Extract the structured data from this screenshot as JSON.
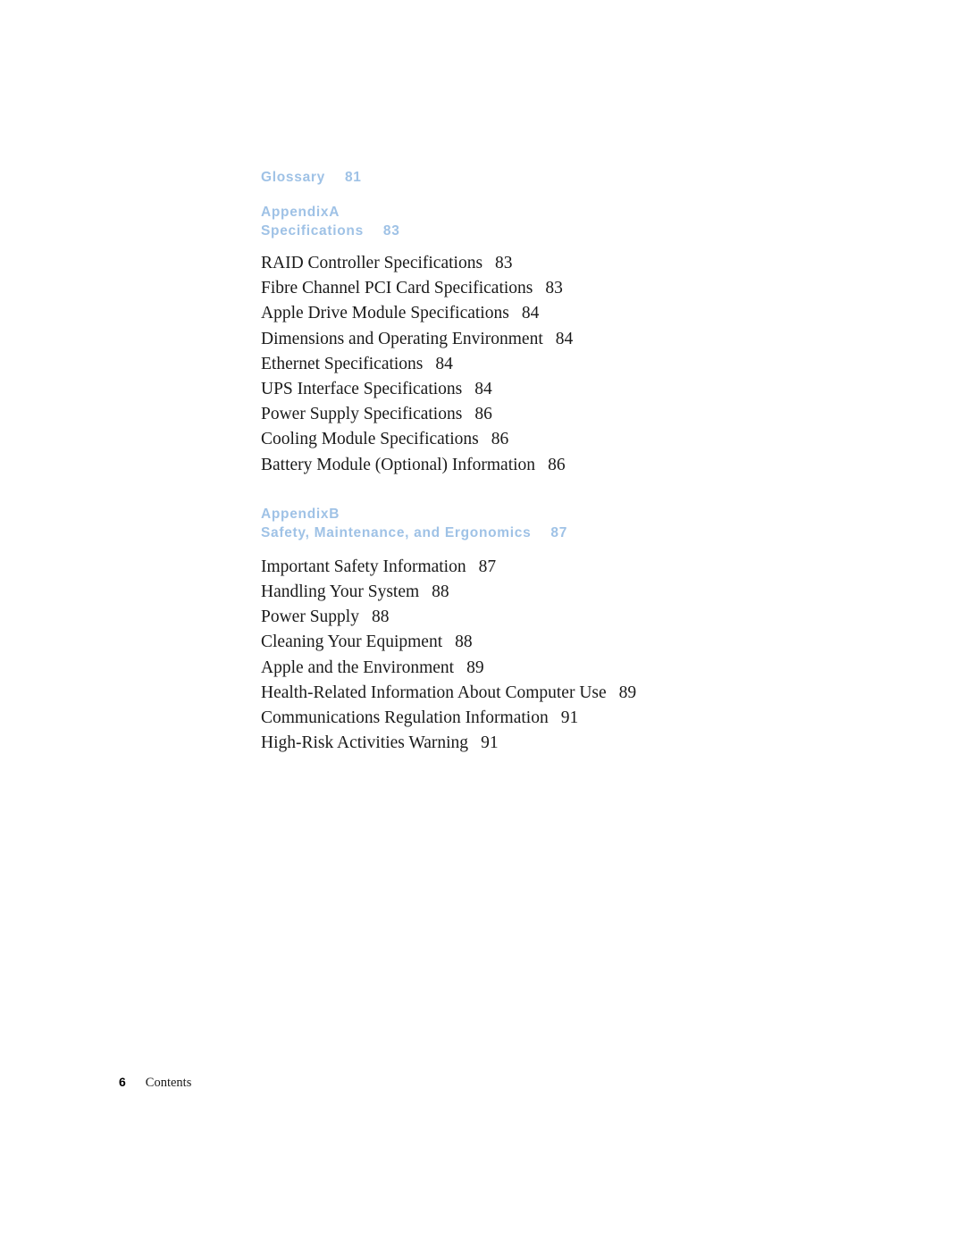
{
  "document": {
    "kind": "table-of-contents",
    "heading_color": "#9fc2e6",
    "body_color": "#1a1a1a",
    "background_color": "#ffffff"
  },
  "toc": {
    "glossary": {
      "label": "Glossary",
      "page": "81"
    },
    "appendix_a": {
      "appendix_label": "Appendix",
      "appendix_letter": "A",
      "title": "Specifications",
      "page": "83",
      "entries": [
        {
          "label": "RAID Controller Specifications",
          "page": "83"
        },
        {
          "label": "Fibre Channel PCI Card Specifications",
          "page": "83"
        },
        {
          "label": "Apple Drive Module Specifications",
          "page": "84"
        },
        {
          "label": "Dimensions and Operating Environment",
          "page": "84"
        },
        {
          "label": "Ethernet Specifications",
          "page": "84"
        },
        {
          "label": "UPS Interface Specifications",
          "page": "84"
        },
        {
          "label": "Power Supply Specifications",
          "page": "86"
        },
        {
          "label": "Cooling Module Specifications",
          "page": "86"
        },
        {
          "label": "Battery Module (Optional) Information",
          "page": "86"
        }
      ]
    },
    "appendix_b": {
      "appendix_label": "Appendix",
      "appendix_letter": "B",
      "title": "Safety, Maintenance, and Ergonomics",
      "page": "87",
      "entries": [
        {
          "label": "Important Safety Information",
          "page": "87"
        },
        {
          "label": "Handling Your System",
          "page": "88"
        },
        {
          "label": "Power Supply",
          "page": "88"
        },
        {
          "label": "Cleaning Your Equipment",
          "page": "88"
        },
        {
          "label": "Apple and the Environment",
          "page": "89"
        },
        {
          "label": "Health-Related Information About Computer Use",
          "page": "89"
        },
        {
          "label": "Communications Regulation Information",
          "page": "91"
        },
        {
          "label": "High-Risk Activities Warning",
          "page": "91"
        }
      ]
    }
  },
  "footer": {
    "folio": "6",
    "label": "Contents"
  }
}
